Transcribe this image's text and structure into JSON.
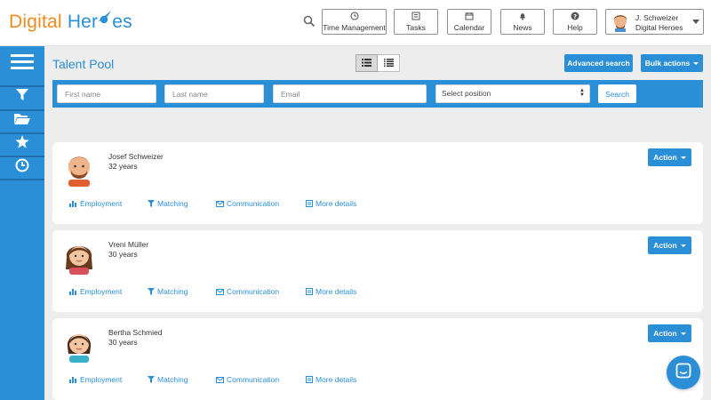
{
  "brand": {
    "part1": "Digital",
    "part2": "Her",
    "part3": "es"
  },
  "nav": [
    {
      "label": "Time Management",
      "icon": "clock-icon"
    },
    {
      "label": "Tasks",
      "icon": "tasks-icon"
    },
    {
      "label": "Calendar",
      "icon": "calendar-icon"
    },
    {
      "label": "News",
      "icon": "bell-icon"
    },
    {
      "label": "Help",
      "icon": "help-icon"
    }
  ],
  "user": {
    "name": "J. Schweizer",
    "company": "Digital Heroes"
  },
  "sidebar": [
    "menu-icon",
    "filter-icon",
    "folder-icon",
    "star-icon",
    "history-icon"
  ],
  "page": {
    "title": "Talent Pool",
    "advanced_search": "Advanced search",
    "bulk_actions": "Bulk actions"
  },
  "filters": {
    "first_name_placeholder": "First name",
    "last_name_placeholder": "Last name",
    "email_placeholder": "Email",
    "position_selected": "Select position",
    "search_label": "Search"
  },
  "candidates": [
    {
      "name": "Josef Schweizer",
      "age": "32 years"
    },
    {
      "name": "Vreni Müller",
      "age": "30 years"
    },
    {
      "name": "Bertha Schmied",
      "age": "30 years"
    }
  ],
  "card_labels": {
    "action": "Action",
    "employment": "Employment",
    "matching": "Matching",
    "communication": "Communication",
    "more_details": "More details"
  },
  "colors": {
    "primary": "#2a8fd6",
    "brand_orange": "#f08a1c",
    "background": "#ededed"
  }
}
